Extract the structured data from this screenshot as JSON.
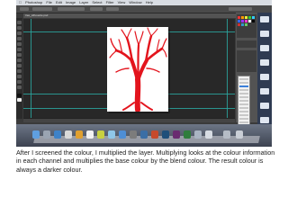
{
  "menubar": {
    "items": [
      "Photoshop",
      "File",
      "Edit",
      "Image",
      "Layer",
      "Select",
      "Filter",
      "View",
      "Window",
      "Help"
    ]
  },
  "document_tab": {
    "label": "tree_silhouette.psd"
  },
  "caption": {
    "text": "After I screened the colour, I multiplied the layer. Multiplying looks at the colour information in each channel and multiplies the base colour by the blend colour. The result colour is always a darker colour."
  },
  "colors": {
    "tree": "#e3141d",
    "guides": "#2aa7a0",
    "workspace": "#282828",
    "panel": "#535353"
  },
  "icons": [
    "apple-logo-icon",
    "tree-artwork",
    "dock-icons"
  ]
}
